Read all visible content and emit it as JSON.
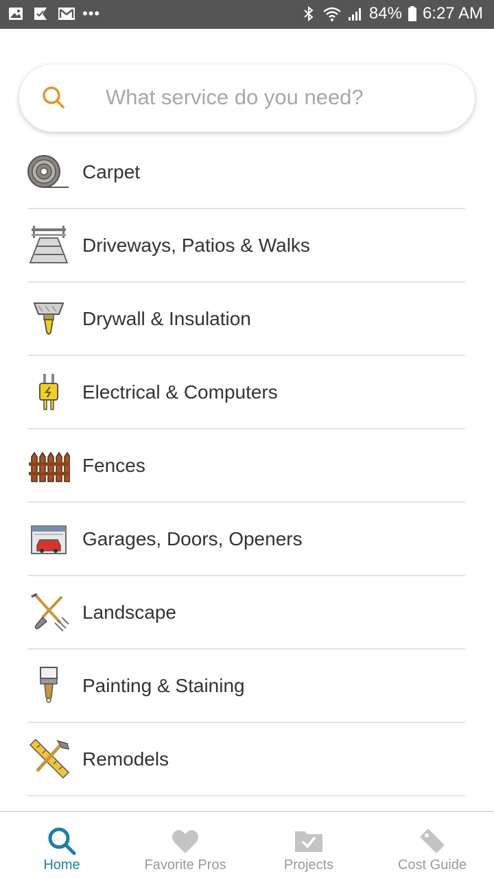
{
  "status_bar": {
    "left_icons": [
      "gallery-icon",
      "check-icon",
      "gmail-icon"
    ],
    "more": "•••",
    "right_icons": [
      "bluetooth-icon",
      "wifi-icon",
      "signal-icon"
    ],
    "battery": "84%",
    "time": "6:27 AM"
  },
  "search": {
    "placeholder": "What service do you need?",
    "icon_color": "#e0972a"
  },
  "categories": [
    {
      "label": "Carpet",
      "icon": "carpet-roll-icon"
    },
    {
      "label": "Driveways, Patios & Walks",
      "icon": "driveway-icon"
    },
    {
      "label": "Drywall & Insulation",
      "icon": "putty-knife-icon"
    },
    {
      "label": "Electrical & Computers",
      "icon": "plug-icon"
    },
    {
      "label": "Fences",
      "icon": "fence-icon"
    },
    {
      "label": "Garages, Doors, Openers",
      "icon": "garage-icon"
    },
    {
      "label": "Landscape",
      "icon": "shovel-rake-icon"
    },
    {
      "label": "Painting & Staining",
      "icon": "paintbrush-icon"
    },
    {
      "label": "Remodels",
      "icon": "hammer-ruler-icon"
    }
  ],
  "bottom_nav": {
    "home": "Home",
    "favorite_pros": "Favorite Pros",
    "projects": "Projects",
    "cost_guide": "Cost Guide",
    "active_color": "#1d7fa3",
    "inactive_color": "#c4c4c4"
  }
}
